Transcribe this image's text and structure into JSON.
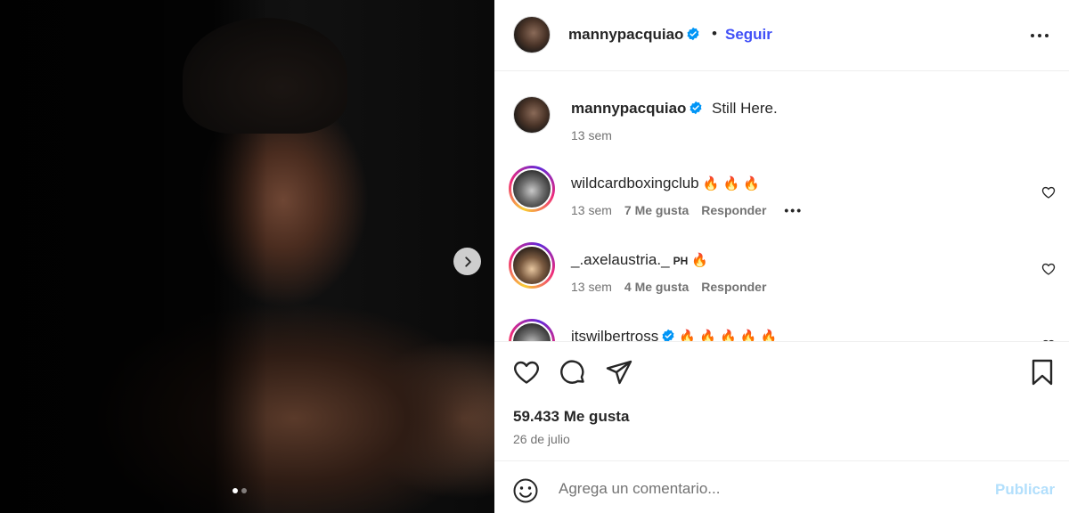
{
  "photo": {
    "carousel_dots": 2,
    "active_dot": 1,
    "next_icon": "chevron-right-icon"
  },
  "header": {
    "username": "mannypacquiao",
    "separator": "•",
    "follow_label": "Seguir",
    "more_icon": "more-horizontal-icon"
  },
  "caption": {
    "username": "mannypacquiao",
    "text": "Still Here.",
    "time": "13 sem"
  },
  "comments": [
    {
      "username": "wildcardboxingclub",
      "tag": "",
      "emojis": "🔥 🔥 🔥",
      "time": "13 sem",
      "likes": "7 Me gusta",
      "reply": "Responder",
      "options": "•••"
    },
    {
      "username": "_.axelaustria._",
      "tag": "PH",
      "emojis": "🔥",
      "time": "13 sem",
      "likes": "4 Me gusta",
      "reply": "Responder",
      "options": ""
    },
    {
      "username": "itswilbertross",
      "tag": "",
      "emojis": "🔥 🔥 🔥 🔥 🔥",
      "time": "",
      "likes": "",
      "reply": "",
      "options": ""
    }
  ],
  "actions": {
    "likes_count": "59.433 Me gusta",
    "date": "26 de julio"
  },
  "comment_bar": {
    "placeholder": "Agrega un comentario...",
    "publish_label": "Publicar"
  },
  "colors": {
    "accent": "#4150f7",
    "publish_disabled": "#b2dffc",
    "verified": "#0095f6",
    "muted_text": "#737373"
  }
}
